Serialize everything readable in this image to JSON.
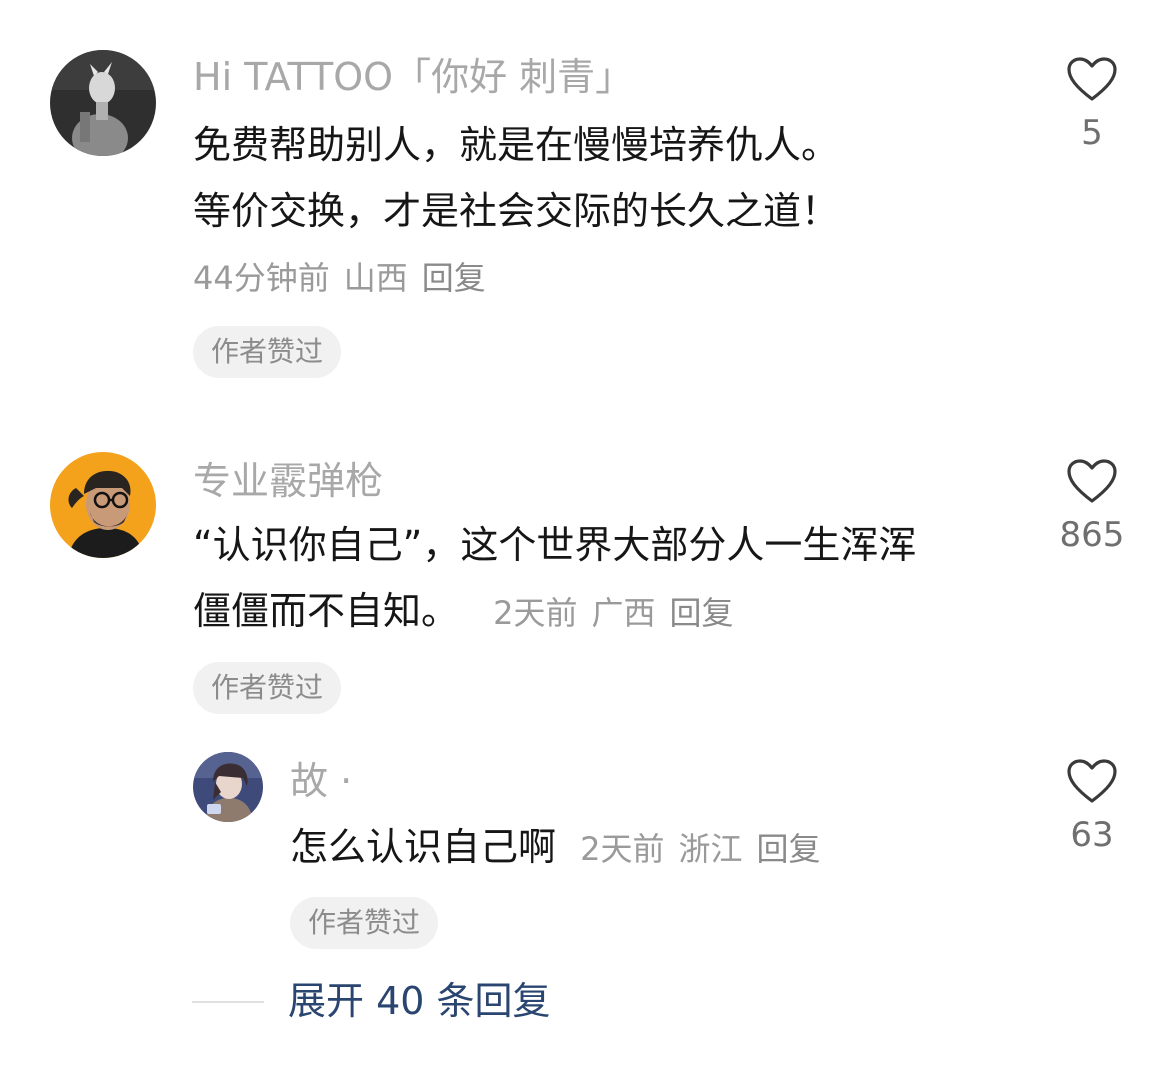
{
  "colors": {
    "username": "#a8a8a8",
    "meta": "#9a9a9a",
    "badge_bg": "#f1f1f1",
    "expand_link": "#2a4670"
  },
  "comments": [
    {
      "username": "Hi TATTOO「你好 刺青」",
      "text_lines": [
        "免费帮助别人，就是在慢慢培养仇人。",
        "等价交换，才是社会交际的长久之道！"
      ],
      "time": "44分钟前",
      "location": "山西",
      "reply_label": "回复",
      "badge": "作者赞过",
      "likes": "5",
      "avatar_icon": "dog-mask-avatar-icon"
    },
    {
      "username": "专业霰弹枪",
      "text_lines": [
        "“认识你自己”，这个世界大部分人一生浑浑",
        "僵僵而不自知。"
      ],
      "time": "2天前",
      "location": "广西",
      "reply_label": "回复",
      "badge": "作者赞过",
      "likes": "865",
      "avatar_icon": "bearded-man-avatar-icon",
      "replies": [
        {
          "username": "故 ·",
          "text": "怎么认识自己啊",
          "time": "2天前",
          "location": "浙江",
          "reply_label": "回复",
          "badge": "作者赞过",
          "likes": "63",
          "avatar_icon": "anime-character-avatar-icon"
        }
      ],
      "expand_label": "展开 40 条回复"
    }
  ]
}
